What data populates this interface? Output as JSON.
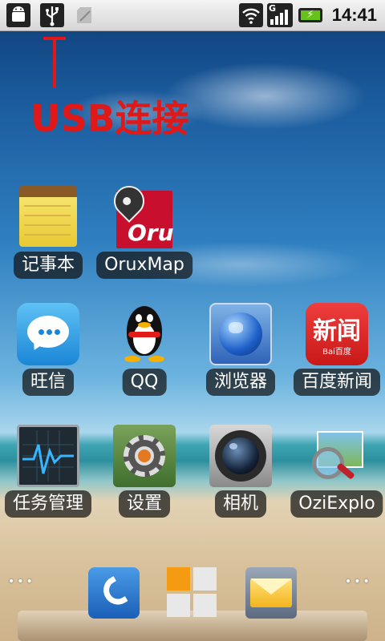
{
  "status_bar": {
    "time": "14:41",
    "signal_label": "G",
    "icons": [
      "android-debug-icon",
      "usb-icon",
      "sd-card-icon",
      "wifi-icon",
      "signal-icon",
      "battery-charging-icon"
    ]
  },
  "annotation": {
    "text": "USB连接",
    "color": "#e01818"
  },
  "apps": [
    {
      "name": "记事本"
    },
    {
      "name": "OruxMap"
    },
    {
      "name": "旺信"
    },
    {
      "name": "QQ"
    },
    {
      "name": "浏览器"
    },
    {
      "name": "百度新闻"
    },
    {
      "name": "任务管理"
    },
    {
      "name": "设置"
    },
    {
      "name": "相机"
    },
    {
      "name": "OziExplo"
    }
  ],
  "oruxmaps_icon_text": "Oru",
  "baidu_icon_text": "新闻",
  "baidu_icon_small": "Bai百度",
  "dock": {
    "left_dots": "•••",
    "right_dots": "•••"
  }
}
